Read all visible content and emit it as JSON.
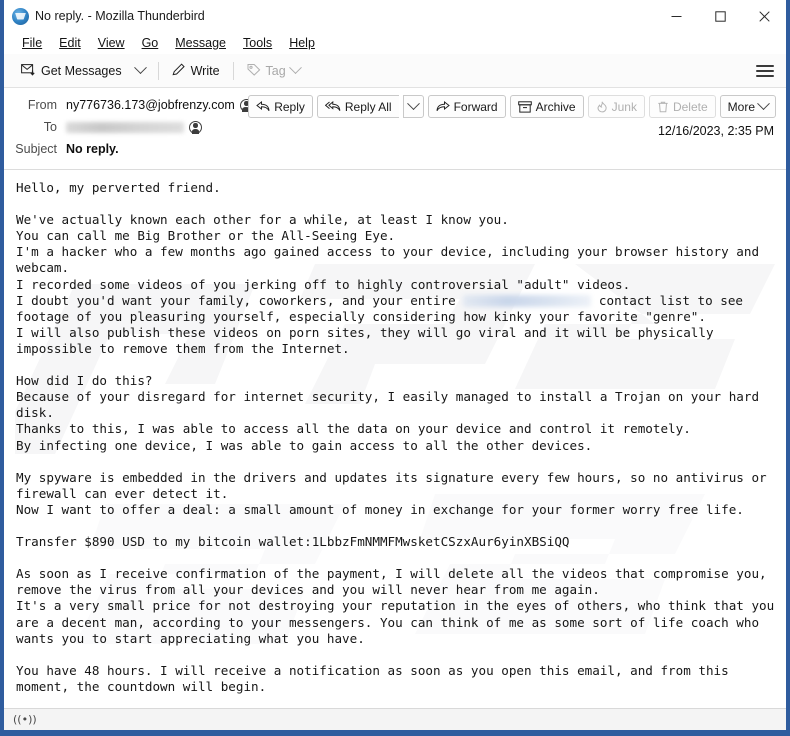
{
  "window": {
    "title": "No reply. - Mozilla Thunderbird",
    "logo_icon": "thunderbird-icon",
    "controls": {
      "minimize": "minimize-icon",
      "maximize": "maximize-icon",
      "close": "close-icon"
    }
  },
  "menubar": {
    "items": [
      {
        "label": "File"
      },
      {
        "label": "Edit"
      },
      {
        "label": "View"
      },
      {
        "label": "Go"
      },
      {
        "label": "Message"
      },
      {
        "label": "Tools"
      },
      {
        "label": "Help"
      }
    ]
  },
  "toolbar": {
    "get_messages": "Get Messages",
    "get_messages_icon": "envelope-download-icon",
    "get_messages_chevron": "chevron-down-icon",
    "write": "Write",
    "write_icon": "pencil-icon",
    "tag": "Tag",
    "tag_icon": "tag-icon",
    "tag_chevron": "chevron-down-icon",
    "tag_disabled": true,
    "app_menu_icon": "hamburger-menu-icon"
  },
  "message_header": {
    "from_label": "From",
    "from_value": "ny776736.173@jobfrenzy.com",
    "from_contact_icon": "contact-avatar-icon",
    "to_label": "To",
    "to_value": "",
    "to_redacted": true,
    "to_contact_icon": "contact-avatar-icon",
    "subject_label": "Subject",
    "subject_value": "No reply.",
    "date": "12/16/2023, 2:35 PM",
    "actions": [
      {
        "label": "Reply",
        "icon": "reply-arrow-icon",
        "disabled": false
      },
      {
        "label": "Reply All",
        "icon": "reply-all-arrow-icon",
        "disabled": false
      },
      {
        "label": "Forward",
        "icon": "forward-arrow-icon",
        "disabled": false
      },
      {
        "label": "Archive",
        "icon": "archive-box-icon",
        "disabled": false
      },
      {
        "label": "Junk",
        "icon": "junk-flame-icon",
        "disabled": true
      },
      {
        "label": "Delete",
        "icon": "trash-icon",
        "disabled": true
      },
      {
        "label": "More",
        "icon": "chevron-down-icon",
        "disabled": false
      }
    ],
    "reply_all_chevron": "chevron-down-icon"
  },
  "body": {
    "para_1": "Hello, my perverted friend.",
    "para_2_line_1": "We've actually known each other for a while, at least I know you.",
    "para_2_line_2": "You can call me Big Brother or the All-Seeing Eye.",
    "para_2_line_3": "I'm a hacker who a few months ago gained access to your device, including your browser history and webcam.",
    "para_2_line_4": "I recorded some videos of you jerking off to highly controversial \"adult\" videos.",
    "para_2_line_5a": "I doubt you'd want your family, coworkers, and your entire ",
    "para_2_line_5b": " contact list to see footage of you pleasuring yourself, especially considering how kinky your favorite \"genre\".",
    "para_2_line_6": "I will also publish these videos on porn sites, they will go viral and it will be physically impossible to remove them from the Internet.",
    "para_3_line_1": "How did I do this?",
    "para_3_line_2": "Because of your disregard for internet security, I easily managed to install a Trojan on your hard disk.",
    "para_3_line_3": "Thanks to this, I was able to access all the data on your device and control it remotely.",
    "para_3_line_4": "By infecting one device, I was able to gain access to all the other devices.",
    "para_4_line_1": "My spyware is embedded in the drivers and updates its signature every few hours, so no antivirus or firewall can ever detect it.",
    "para_4_line_2": "Now I want to offer a deal: a small amount of money in exchange for your former worry free life.",
    "para_5": "Transfer $890 USD to my bitcoin wallet:1LbbzFmNMMFMwsketCSzxAur6yinXBSiQQ",
    "ransom_amount": "$890 USD",
    "bitcoin_wallet": "1LbbzFmNMMFMwsketCSzxAur6yinXBSiQQ",
    "para_6_line_1": "As soon as I receive confirmation of the payment, I will delete all the videos that compromise you, remove the virus from all your devices and you will never hear from me again.",
    "para_6_line_2": "It's a very small price for not destroying your reputation in the eyes of others, who think that you are a decent man, according to your messengers. You can think of me as some sort of life coach who wants you to start appreciating what you have.",
    "para_7": "You have 48 hours. I will receive a notification as soon as you open this email, and from this moment, the countdown will begin.",
    "deadline": "48 hours",
    "watermark_text": "PC"
  },
  "statusbar": {
    "icon": "broadcast-icon",
    "glyph": "((•))"
  },
  "colors": {
    "window_border": "#2f5c9e",
    "titlebar_bg": "#ffffff",
    "toolbar_bg": "#fbfbfb",
    "body_bg": "#ffffff",
    "text": "#161616"
  }
}
